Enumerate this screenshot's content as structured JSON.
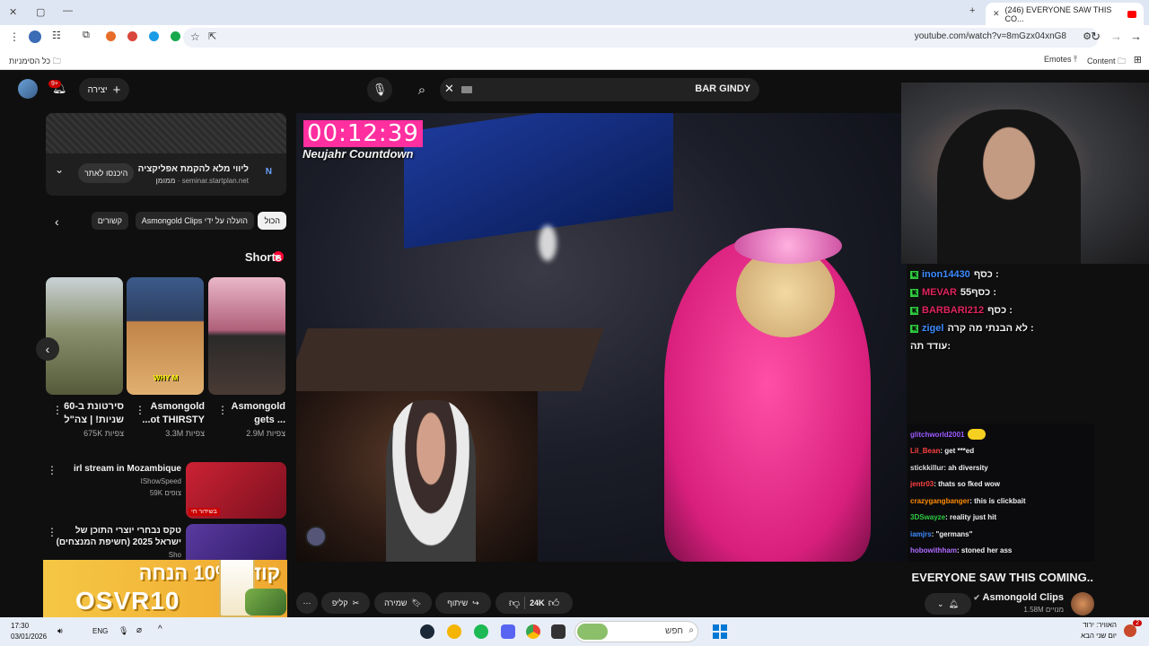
{
  "browser": {
    "tab_title": "(246) EVERYONE SAW THIS CO...",
    "url": "youtube.com/watch?v=8mGzx04xnG8",
    "bookmarks_label": "כל הסימניות",
    "bookmark_emotes": "Emotes",
    "bookmark_content": "Content"
  },
  "yt_header": {
    "search_query": "BAR GINDY",
    "create_label": "יצירה",
    "notif_count": "9+"
  },
  "ad": {
    "title": "ליווי מלא להקמת אפליקציה",
    "domain": "seminar.startplan.net",
    "sponsored": "ממומן",
    "cta": "היכנסו לאתר"
  },
  "chips": [
    "הכול",
    "Asmongold Clips הועלה על ידי",
    "קשורים"
  ],
  "shorts": {
    "title": "Shorts",
    "items": [
      {
        "caption": "Asmongold gets ...",
        "views": "2.9M צפיות"
      },
      {
        "caption": "Asmongold ...ot THIRSTY",
        "views": "3.3M צפיות"
      },
      {
        "caption": "סירטונת ב-60 שניות! | צה\"ל",
        "views": "675K צפיות"
      }
    ]
  },
  "video_rows": [
    {
      "title": "irl stream in Mozambique",
      "channel": "IShowSpeed",
      "views": "59K צופים",
      "live": "בשידור חי"
    },
    {
      "title": "טקס נבחרי יוצרי התוכן של ישראל 2025 (חשיפת המנצחים)",
      "channel": "Sho"
    }
  ],
  "promo": {
    "line1": "קוד ל10% הנחה",
    "code": "OSVR10"
  },
  "player": {
    "timer": "00:12:39",
    "timer_sub": "Neujahr Countdown"
  },
  "chat_overlay": [
    {
      "user": "inon14430",
      "msg": "כסף :",
      "color": "#3d8bff"
    },
    {
      "user": "MEVAR",
      "msg": "כסף55 :",
      "color": "#e0245e"
    },
    {
      "user": "BARBARI212",
      "msg": "כסף :",
      "color": "#e0245e"
    },
    {
      "user": "zigel",
      "msg": "לא הבנתי מה קרה :",
      "color": "#3d8bff"
    },
    {
      "user": "",
      "msg": "עודד תה:",
      "color": "#ffffff"
    }
  ],
  "chat_twitch": [
    {
      "user": "glitchworld2001",
      "msg": "",
      "color": "#9b59ff"
    },
    {
      "user": "Lil_Bean",
      "msg": "get ***ed",
      "color": "#ff4040"
    },
    {
      "user": "stickkillur",
      "msg": "ah diversity",
      "color": "#dddddd"
    },
    {
      "user": "jentr03",
      "msg": "thats so fked wow",
      "color": "#ff4040"
    },
    {
      "user": "crazygangbanger",
      "msg": "this is clickbait",
      "color": "#ff8c00"
    },
    {
      "user": "3DSwayze",
      "msg": "reality just hit",
      "color": "#2ecc40"
    },
    {
      "user": "iamjrs",
      "msg": "\"germans\"",
      "color": "#3d8bff"
    },
    {
      "user": "hobowithham",
      "msg": "stoned her ass",
      "color": "#b06cff"
    }
  ],
  "video": {
    "title": "EVERYONE SAW THIS COMING..",
    "channel": "Asmongold Clips",
    "subs": "1.58M מנויים",
    "likes": "24K",
    "share": "שיתוף",
    "save": "שמירה",
    "clip": "קליפ"
  },
  "taskbar": {
    "time": "17:30",
    "date": "03/01/2026",
    "lang": "ENG",
    "search_placeholder": "חפש",
    "weather1": "האוויר: ירוד",
    "weather2": "יום שני הבא",
    "weather_badge": "2"
  }
}
